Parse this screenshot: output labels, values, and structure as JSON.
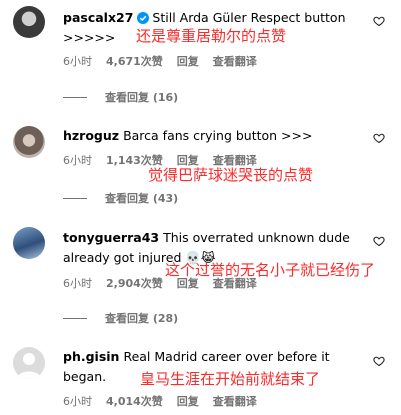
{
  "comments": [
    {
      "username": "pascalx27",
      "verified": true,
      "text": "Still Arda Güler Respect button >>>>>",
      "overlay": "还是尊重居勒尔的点赞",
      "time": "6小时",
      "likes": "4,671次赞",
      "reply": "回复",
      "translate": "查看翻译",
      "view_replies": "查看回复 (16)"
    },
    {
      "username": "hzroguz",
      "verified": false,
      "text": "Barca fans crying button >>>",
      "overlay": "觉得巴萨球迷哭丧的点赞",
      "time": "6小时",
      "likes": "1,143次赞",
      "reply": "回复",
      "translate": "查看翻译",
      "view_replies": "查看回复 (43)"
    },
    {
      "username": "tonyguerra43",
      "verified": false,
      "text": "This overrated unknown dude already got injured 💀😹",
      "overlay": "这个过誉的无名小子就已经伤了",
      "time": "6小时",
      "likes": "2,904次赞",
      "reply": "回复",
      "translate": "查看翻译",
      "view_replies": "查看回复 (28)"
    },
    {
      "username": "ph.gisin",
      "verified": false,
      "text": "Real Madrid career over before it began.",
      "overlay": "皇马生涯在开始前就结束了",
      "time": "6小时",
      "likes": "4,014次赞",
      "reply": "回复",
      "translate": "查看翻译"
    }
  ],
  "colors": {
    "overlay": "#ff2a2a",
    "meta": "#737373",
    "verified": "#0095f6"
  },
  "icons": {
    "like": "heart-outline-icon",
    "verified": "verified-badge-icon",
    "default_avatar": "person-silhouette-icon"
  }
}
